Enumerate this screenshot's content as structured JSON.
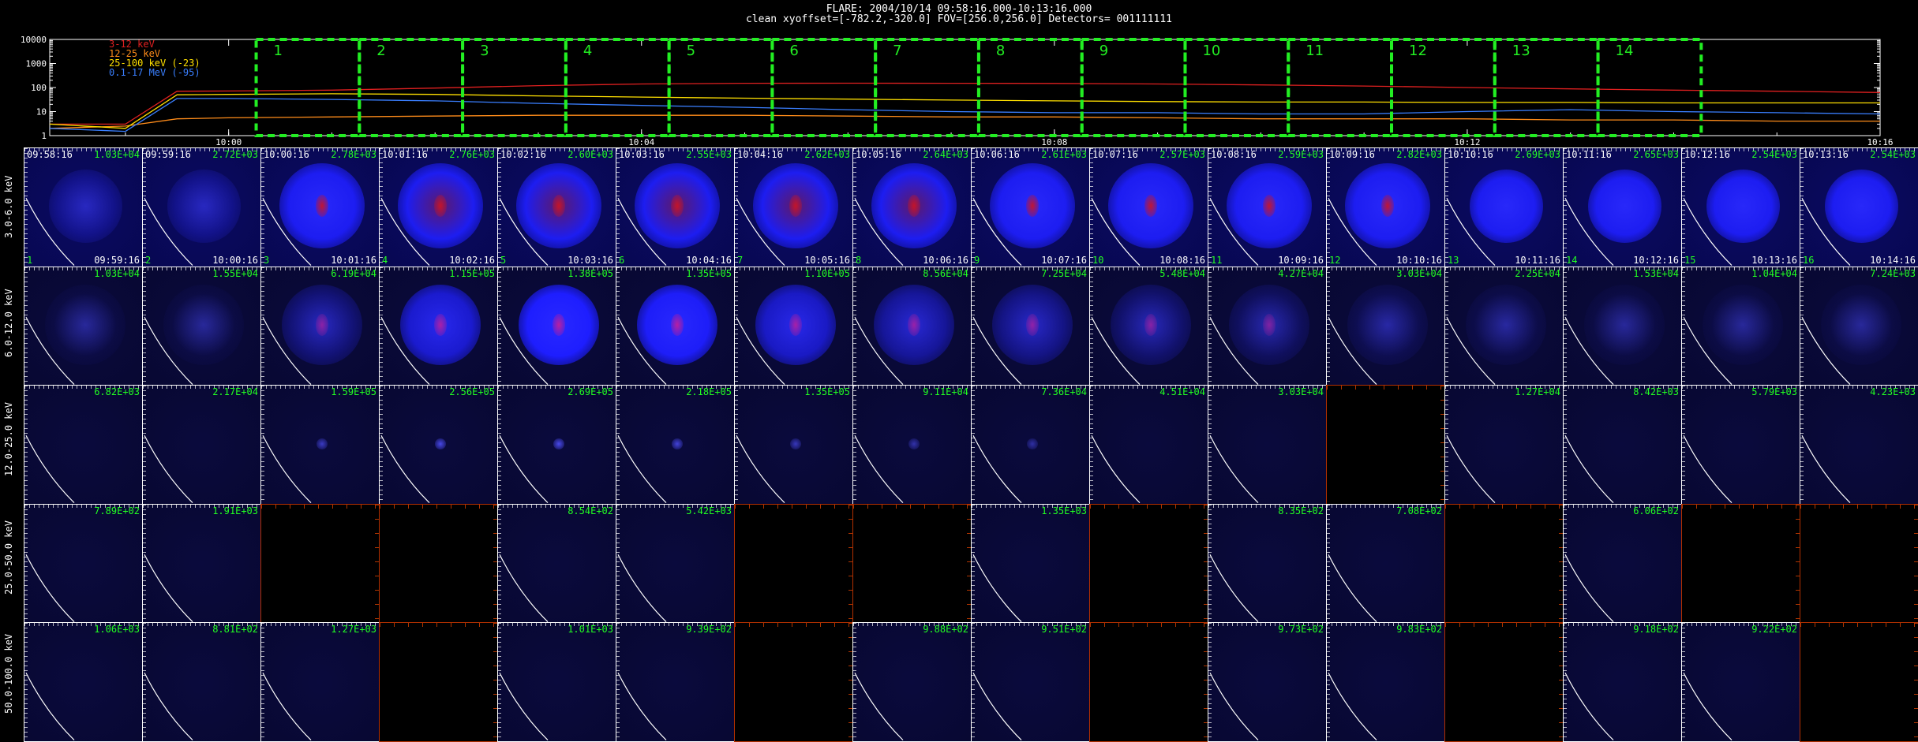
{
  "header": {
    "line1": "FLARE: 2004/10/14  09:58:16.000-10:13:16.000",
    "line2": "clean    xyoffset=[-782.2,-320.0]   FOV=[256.0,256.0]   Detectors= 001111111"
  },
  "colors": {
    "series_3_12": "#e02020",
    "series_12_25": "#ff8c1a",
    "series_25_100": "#ffe000",
    "series_01_17": "#3a7fff",
    "interval_box": "#22ee22",
    "peak_text": "#22ff22",
    "empty_border": "#c33a00"
  },
  "chart_data": [
    {
      "type": "line",
      "title": "",
      "xlabel": "",
      "ylabel": "",
      "y_scale": "log",
      "ylim": [
        1,
        10000
      ],
      "y_ticks": [
        "1",
        "10",
        "100",
        "1000",
        "10000"
      ],
      "x_range": [
        "09:58:16",
        "10:16:00"
      ],
      "x_ticks": [
        "10:00",
        "10:04",
        "10:08",
        "10:12",
        "10:16"
      ],
      "legend_placement": "top-left",
      "x": [
        "09:58:16",
        "09:59:00",
        "09:59:30",
        "10:00:00",
        "10:01:00",
        "10:02:00",
        "10:03:00",
        "10:04:00",
        "10:05:00",
        "10:06:00",
        "10:07:00",
        "10:08:00",
        "10:09:00",
        "10:10:00",
        "10:11:00",
        "10:12:00",
        "10:13:00",
        "10:14:00",
        "10:15:00",
        "10:16:00"
      ],
      "series": [
        {
          "name": "3-12 keV",
          "color": "#e02020",
          "values": [
            3,
            3,
            70,
            72,
            78,
            95,
            120,
            140,
            150,
            152,
            150,
            148,
            140,
            128,
            115,
            100,
            88,
            78,
            70,
            62
          ]
        },
        {
          "name": "12-25 keV",
          "color": "#ff8c1a",
          "values": [
            2,
            2.5,
            5,
            5.5,
            6,
            6.5,
            7,
            7,
            7,
            6.5,
            6,
            6,
            5.5,
            5,
            5,
            5,
            4.5,
            4.5,
            4,
            4
          ]
        },
        {
          "name": "25-100 keV (-23)",
          "color": "#ffe000",
          "values": [
            3,
            2,
            50,
            52,
            55,
            52,
            45,
            40,
            36,
            33,
            30,
            28,
            26,
            25,
            25,
            24,
            24,
            23,
            23,
            23
          ]
        },
        {
          "name": "0.1-17 MeV (-95)",
          "color": "#3a7fff",
          "values": [
            2,
            1.5,
            35,
            35,
            32,
            28,
            22,
            18,
            15,
            12,
            10,
            9,
            9,
            8,
            8,
            10,
            12,
            10,
            9,
            8
          ]
        }
      ],
      "intervals": [
        "1",
        "2",
        "3",
        "4",
        "5",
        "6",
        "7",
        "8",
        "9",
        "10",
        "11",
        "12",
        "13",
        "14",
        "15",
        "16"
      ]
    },
    {
      "type": "heatmap",
      "rows": [
        "3.0-6.0 keV",
        "6.0-12.0 keV",
        "12.0-25.0 keV",
        "25.0-50.0 keV",
        "50.0-100.0 keV"
      ],
      "column_start_times": [
        "09:58:16",
        "09:59:16",
        "10:00:16",
        "10:01:16",
        "10:02:16",
        "10:03:16",
        "10:04:16",
        "10:05:16",
        "10:06:16",
        "10:07:16",
        "10:08:16",
        "10:09:16",
        "10:10:16",
        "10:11:16",
        "10:12:16",
        "10:13:16"
      ],
      "column_end_times": [
        "09:59:16",
        "10:00:16",
        "10:01:16",
        "10:02:16",
        "10:03:16",
        "10:04:16",
        "10:05:16",
        "10:06:16",
        "10:07:16",
        "10:08:16",
        "10:09:16",
        "10:10:16",
        "10:11:16",
        "10:12:16",
        "10:13:16",
        "10:14:16"
      ],
      "column_index": [
        "1",
        "2",
        "3",
        "4",
        "5",
        "6",
        "7",
        "8",
        "9",
        "10",
        "11",
        "12",
        "13",
        "14",
        "15",
        "16"
      ],
      "peaks": [
        [
          "1.03E+04",
          "2.72E+03",
          "2.78E+03",
          "2.76E+03",
          "2.60E+03",
          "2.55E+03",
          "2.62E+03",
          "2.64E+03",
          "2.61E+03",
          "2.57E+03",
          "2.59E+03",
          "2.82E+03",
          "2.69E+03",
          "2.65E+03",
          "2.54E+03",
          "2.54E+03"
        ],
        [
          "1.03E+04",
          "1.55E+04",
          "6.19E+04",
          "1.15E+05",
          "1.38E+05",
          "1.35E+05",
          "1.10E+05",
          "8.56E+04",
          "7.25E+04",
          "5.48E+04",
          "4.27E+04",
          "3.03E+04",
          "2.25E+04",
          "1.53E+04",
          "1.04E+04",
          "7.24E+03"
        ],
        [
          "6.82E+03",
          "2.17E+04",
          "1.59E+05",
          "2.56E+05",
          "2.69E+05",
          "2.18E+05",
          "1.35E+05",
          "9.11E+04",
          "7.36E+04",
          "4.51E+04",
          "3.03E+04",
          "",
          "1.27E+04",
          "8.42E+03",
          "5.79E+03",
          "4.23E+03"
        ],
        [
          "7.89E+02",
          "1.91E+03",
          "",
          "",
          "8.54E+02",
          "5.42E+03",
          "",
          "",
          "1.35E+03",
          "",
          "8.35E+02",
          "7.08E+02",
          "",
          "6.06E+02",
          "",
          ""
        ],
        [
          "1.06E+03",
          "8.81E+02",
          "1.27E+03",
          "",
          "1.01E+03",
          "9.39E+02",
          "",
          "9.88E+02",
          "9.51E+02",
          "",
          "9.73E+02",
          "9.83E+02",
          "",
          "9.18E+02",
          "9.22E+02",
          ""
        ]
      ]
    }
  ]
}
